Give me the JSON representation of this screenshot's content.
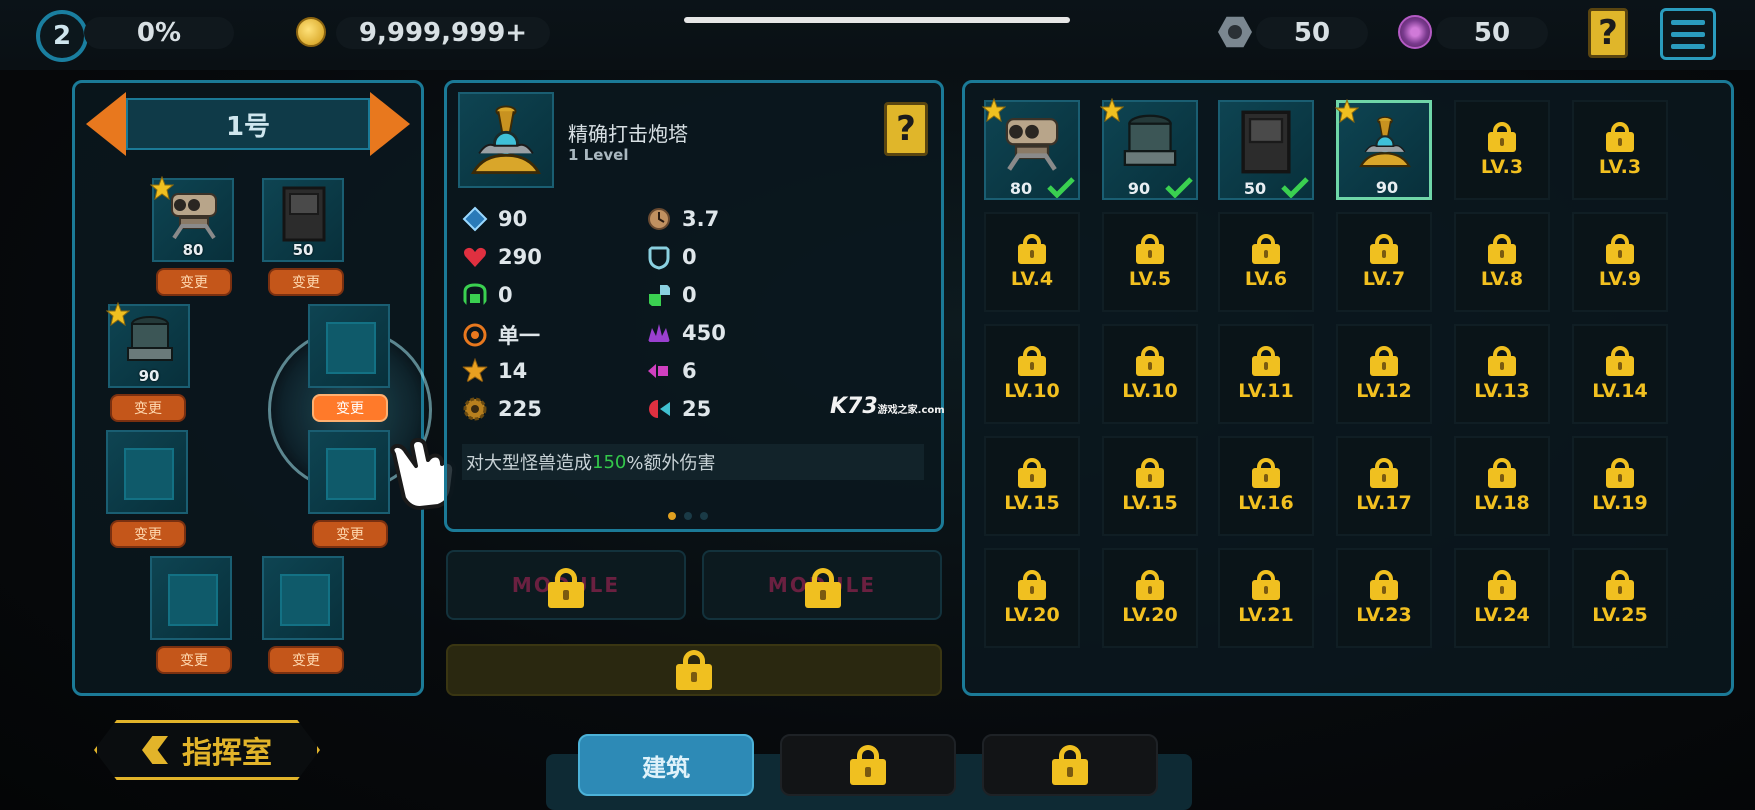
{
  "topbar": {
    "level": "2",
    "progress": "0%",
    "gold": "9,999,999+",
    "bolts": "50",
    "gems": "50",
    "icons": [
      "gold-coin-icon",
      "hex-bolt-icon",
      "purple-gem-icon",
      "help-book-icon",
      "menu-icon"
    ]
  },
  "loadout": {
    "name": "1号",
    "slots": [
      {
        "turret": "twin-cannon",
        "value": "80",
        "button": "变更"
      },
      {
        "turret": "box-tower",
        "value": "50",
        "button": "变更"
      },
      {
        "turret": "mortar",
        "value": "90",
        "button": "变更"
      },
      {
        "turret": "",
        "value": "",
        "button": "变更"
      },
      {
        "turret": "",
        "value": "",
        "button": "变更"
      },
      {
        "turret": "",
        "value": "",
        "button": "变更"
      },
      {
        "turret": "",
        "value": "",
        "button": "变更"
      },
      {
        "turret": "",
        "value": "",
        "button": "变更"
      }
    ]
  },
  "detail": {
    "name": "精确打击炮塔",
    "level": "1 Level",
    "stats_left": [
      {
        "icon": "diamond-icon",
        "value": "90"
      },
      {
        "icon": "heart-icon",
        "value": "290"
      },
      {
        "icon": "shield-lock-icon",
        "value": "0"
      },
      {
        "icon": "crosshair-icon",
        "value": "单一"
      },
      {
        "icon": "burst-icon",
        "value": "14"
      },
      {
        "icon": "gear-icon",
        "value": "225"
      }
    ],
    "stats_right": [
      {
        "icon": "clock-icon",
        "value": "3.7"
      },
      {
        "icon": "armor-icon",
        "value": "0"
      },
      {
        "icon": "regen-icon",
        "value": "0"
      },
      {
        "icon": "splash-icon",
        "value": "450"
      },
      {
        "icon": "pierce-icon",
        "value": "6"
      },
      {
        "icon": "knockback-icon",
        "value": "25"
      }
    ],
    "desc_pre": "对大型怪兽造成",
    "desc_hl": "150",
    "desc_post": "%额外伤害",
    "module_label": "MODULE"
  },
  "grid": {
    "owned": [
      {
        "turret": "twin-cannon",
        "value": "80",
        "check": true
      },
      {
        "turret": "mortar",
        "value": "90",
        "check": true
      },
      {
        "turret": "box-tower",
        "value": "50",
        "check": true
      },
      {
        "turret": "precision-tower",
        "value": "90",
        "check": false
      }
    ],
    "locked": [
      "LV.3",
      "LV.3",
      "LV.4",
      "LV.5",
      "LV.6",
      "LV.7",
      "LV.8",
      "LV.9",
      "LV.10",
      "LV.10",
      "LV.11",
      "LV.12",
      "LV.13",
      "LV.14",
      "LV.15",
      "LV.15",
      "LV.16",
      "LV.17",
      "LV.18",
      "LV.19",
      "LV.20",
      "LV.20",
      "LV.21",
      "LV.23",
      "LV.24",
      "LV.25"
    ]
  },
  "bottom": {
    "back_label": "指挥室",
    "tab_build": "建筑"
  },
  "watermark": {
    "brand": "K73",
    "sub": "游戏之家",
    "domain": ".com"
  },
  "colors": {
    "accent": "#1b7a97",
    "gold": "#f0c020",
    "orange": "#e8781e"
  }
}
